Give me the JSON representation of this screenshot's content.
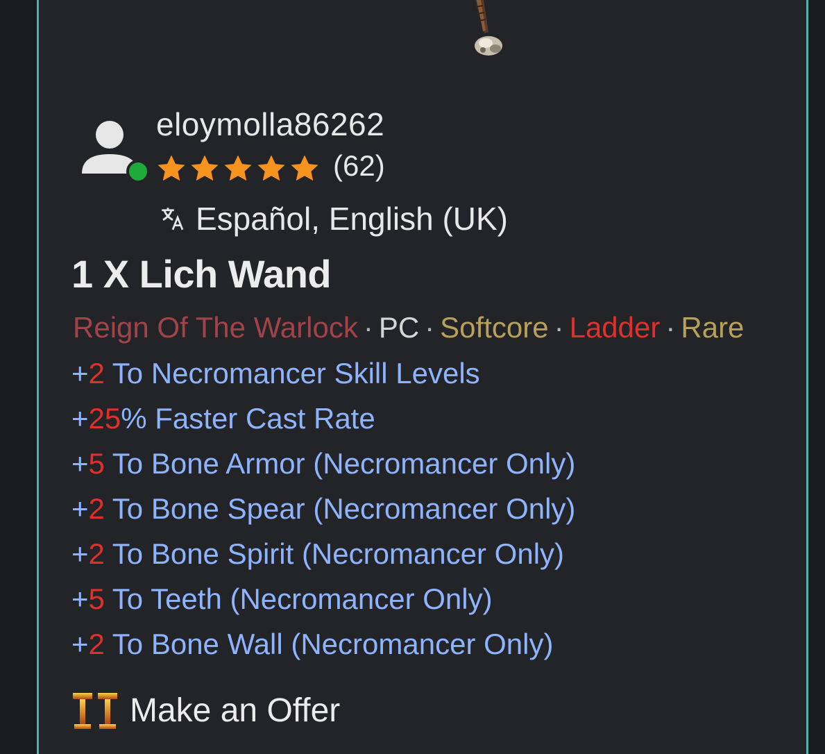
{
  "seller": {
    "username": "eloymolla86262",
    "rating_stars": 5,
    "rating_count": "(62)",
    "online": true,
    "languages": "Español, English (UK)"
  },
  "listing": {
    "title": "1 X Lich Wand",
    "tags": [
      {
        "text": "Reign Of The Warlock",
        "color": "#a2434a"
      },
      {
        "text": "PC",
        "color": "#d6d6d6"
      },
      {
        "text": "Softcore",
        "color": "#b8a15a"
      },
      {
        "text": "Ladder",
        "color": "#e0302b"
      },
      {
        "text": "Rare",
        "color": "#b8a15a"
      }
    ],
    "stats": [
      {
        "prefix": "+",
        "num": "2",
        "text": " To Necromancer Skill Levels"
      },
      {
        "prefix": "+",
        "num": "25",
        "text": "% Faster Cast Rate"
      },
      {
        "prefix": "+",
        "num": "5",
        "text": " To Bone Armor (Necromancer Only)"
      },
      {
        "prefix": "+",
        "num": "2",
        "text": " To Bone Spear (Necromancer Only)"
      },
      {
        "prefix": "+",
        "num": "2",
        "text": " To Bone Spirit (Necromancer Only)"
      },
      {
        "prefix": "+",
        "num": "5",
        "text": " To Teeth (Necromancer Only)"
      },
      {
        "prefix": "+",
        "num": "2",
        "text": " To Bone Wall (Necromancer Only)"
      }
    ]
  },
  "actions": {
    "make_offer_label": "Make an Offer"
  },
  "icons": {
    "star": "star-icon",
    "translate": "translate-icon",
    "auction": "auction-hammer-icon",
    "user": "user-avatar-icon"
  },
  "colors": {
    "accent_border": "#4fb3a9",
    "star": "#f7931e",
    "online": "#1faa3b",
    "stat_text": "#8fb4ff",
    "stat_number": "#e0302b"
  }
}
